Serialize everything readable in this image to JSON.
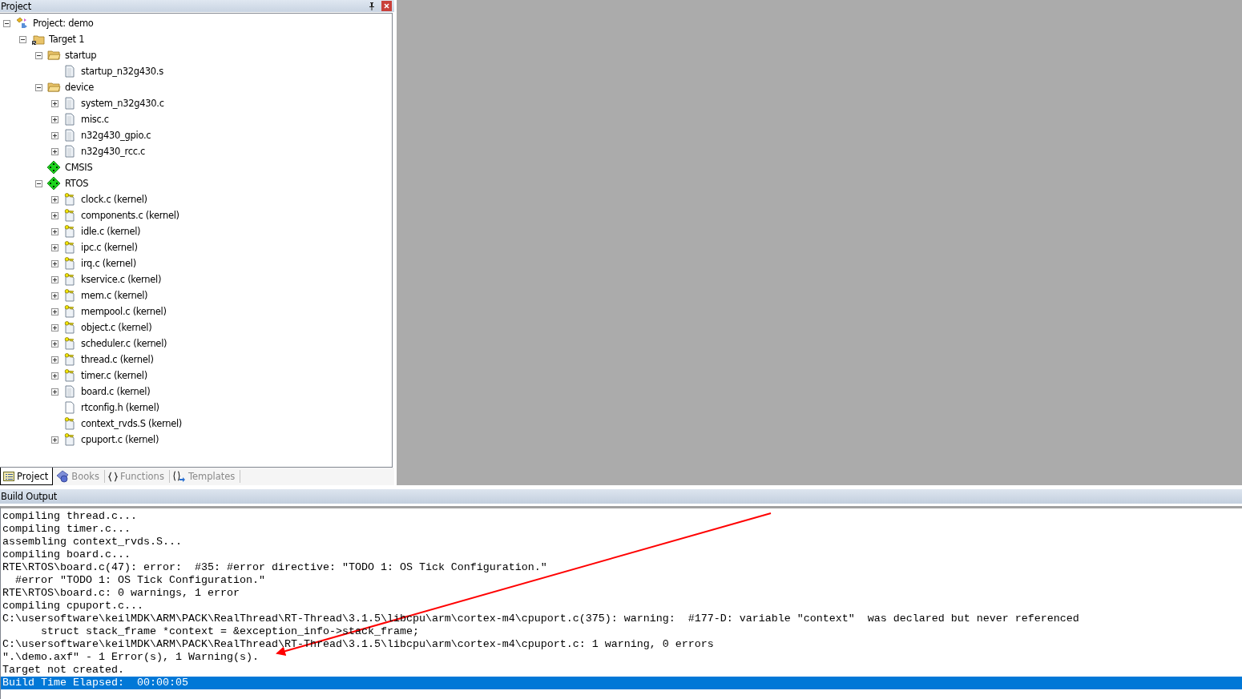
{
  "project_panel": {
    "title": "Project",
    "tree": [
      {
        "label": "Project: demo",
        "kind": "project",
        "expandable": true,
        "expanded": true,
        "children": [
          {
            "label": "Target 1",
            "kind": "target",
            "expandable": true,
            "expanded": true,
            "children": [
              {
                "label": "startup",
                "kind": "folder",
                "expandable": true,
                "expanded": true,
                "children": [
                  {
                    "label": "startup_n32g430.s",
                    "kind": "file",
                    "expandable": false
                  }
                ]
              },
              {
                "label": "device",
                "kind": "folder",
                "expandable": true,
                "expanded": true,
                "children": [
                  {
                    "label": "system_n32g430.c",
                    "kind": "file",
                    "expandable": true,
                    "expanded": false
                  },
                  {
                    "label": "misc.c",
                    "kind": "file",
                    "expandable": true,
                    "expanded": false
                  },
                  {
                    "label": "n32g430_gpio.c",
                    "kind": "file",
                    "expandable": true,
                    "expanded": false
                  },
                  {
                    "label": "n32g430_rcc.c",
                    "kind": "file",
                    "expandable": true,
                    "expanded": false
                  }
                ]
              },
              {
                "label": "CMSIS",
                "kind": "component",
                "expandable": false
              },
              {
                "label": "RTOS",
                "kind": "component",
                "expandable": true,
                "expanded": true,
                "children": [
                  {
                    "label": "clock.c (kernel)",
                    "kind": "locked-file",
                    "expandable": true,
                    "expanded": false
                  },
                  {
                    "label": "components.c (kernel)",
                    "kind": "locked-file",
                    "expandable": true,
                    "expanded": false
                  },
                  {
                    "label": "idle.c (kernel)",
                    "kind": "locked-file",
                    "expandable": true,
                    "expanded": false
                  },
                  {
                    "label": "ipc.c (kernel)",
                    "kind": "locked-file",
                    "expandable": true,
                    "expanded": false
                  },
                  {
                    "label": "irq.c (kernel)",
                    "kind": "locked-file",
                    "expandable": true,
                    "expanded": false
                  },
                  {
                    "label": "kservice.c (kernel)",
                    "kind": "locked-file",
                    "expandable": true,
                    "expanded": false
                  },
                  {
                    "label": "mem.c (kernel)",
                    "kind": "locked-file",
                    "expandable": true,
                    "expanded": false
                  },
                  {
                    "label": "mempool.c (kernel)",
                    "kind": "locked-file",
                    "expandable": true,
                    "expanded": false
                  },
                  {
                    "label": "object.c (kernel)",
                    "kind": "locked-file",
                    "expandable": true,
                    "expanded": false
                  },
                  {
                    "label": "scheduler.c (kernel)",
                    "kind": "locked-file",
                    "expandable": true,
                    "expanded": false
                  },
                  {
                    "label": "thread.c (kernel)",
                    "kind": "locked-file",
                    "expandable": true,
                    "expanded": false
                  },
                  {
                    "label": "timer.c (kernel)",
                    "kind": "locked-file",
                    "expandable": true,
                    "expanded": false
                  },
                  {
                    "label": "board.c (kernel)",
                    "kind": "file",
                    "expandable": true,
                    "expanded": false
                  },
                  {
                    "label": "rtconfig.h (kernel)",
                    "kind": "header",
                    "expandable": false
                  },
                  {
                    "label": "context_rvds.S (kernel)",
                    "kind": "locked-file",
                    "expandable": false
                  },
                  {
                    "label": "cpuport.c (kernel)",
                    "kind": "locked-file",
                    "expandable": true,
                    "expanded": false
                  }
                ]
              }
            ]
          }
        ]
      }
    ],
    "tabs": [
      {
        "label": "Project",
        "kind": "project",
        "selected": true
      },
      {
        "label": "Books",
        "kind": "books",
        "selected": false
      },
      {
        "label": "Functions",
        "kind": "functions",
        "selected": false
      },
      {
        "label": "Templates",
        "kind": "templates",
        "selected": false
      }
    ]
  },
  "build_output": {
    "title": "Build Output",
    "lines": [
      {
        "text": "compiling thread.c...",
        "selected": false
      },
      {
        "text": "compiling timer.c...",
        "selected": false
      },
      {
        "text": "assembling context_rvds.S...",
        "selected": false
      },
      {
        "text": "compiling board.c...",
        "selected": false
      },
      {
        "text": "RTE\\RTOS\\board.c(47): error:  #35: #error directive: \"TODO 1: OS Tick Configuration.\"",
        "selected": false
      },
      {
        "text": "  #error \"TODO 1: OS Tick Configuration.\"",
        "selected": false
      },
      {
        "text": "RTE\\RTOS\\board.c: 0 warnings, 1 error",
        "selected": false
      },
      {
        "text": "compiling cpuport.c...",
        "selected": false
      },
      {
        "text": "C:\\usersoftware\\keilMDK\\ARM\\PACK\\RealThread\\RT-Thread\\3.1.5\\libcpu\\arm\\cortex-m4\\cpuport.c(375): warning:  #177-D: variable \"context\"  was declared but never referenced",
        "selected": false
      },
      {
        "text": "      struct stack_frame *context = &exception_info->stack_frame;",
        "selected": false
      },
      {
        "text": "C:\\usersoftware\\keilMDK\\ARM\\PACK\\RealThread\\RT-Thread\\3.1.5\\libcpu\\arm\\cortex-m4\\cpuport.c: 1 warning, 0 errors",
        "selected": false
      },
      {
        "text": "\".\\demo.axf\" - 1 Error(s), 1 Warning(s).",
        "selected": false
      },
      {
        "text": "Target not created.",
        "selected": false
      },
      {
        "text": "Build Time Elapsed:  00:00:05",
        "selected": true
      }
    ]
  }
}
